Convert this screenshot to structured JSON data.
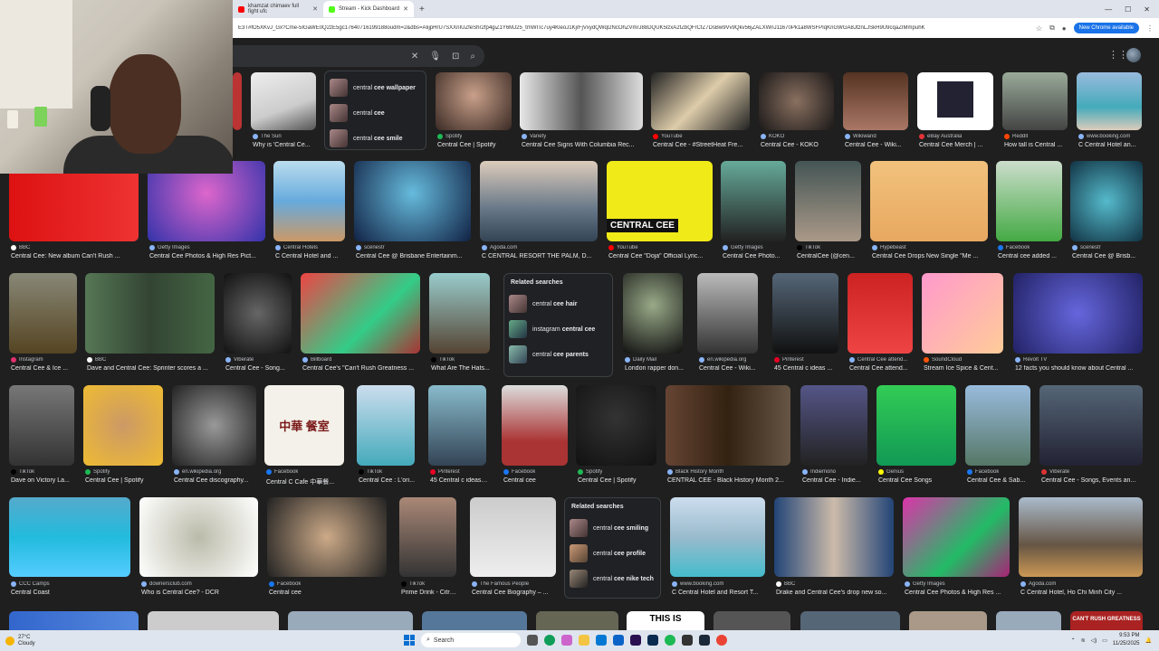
{
  "browser": {
    "tabs": [
      {
        "label": "khamzat chimaev full fight ufc",
        "favicon_color": "#ff0000",
        "active": false
      },
      {
        "label": "Stream - Kick Dashboard",
        "favicon_color": "#53fc18",
        "active": true
      }
    ],
    "url": "E3T#fO5XKvJ_Gx?Cme-5IGaWE0Q2zE5gc17640716199188oudm=2&dbs=AIijpHrU7SXXnIUZfeShr2fp4giZ1Y6MJ25_tmWITc7uy4KleoJ1KjrFjVxydQWql2NcOhZVmrJ88DQUK5lzxA2fZbQFrCfZ7DsBw9Vv9Qkv56jZALXWnJ11670Pk1a8WSFPIqKnGWGA8JtznLJSkH9U9cqaZIMmpuhK",
    "update_chip": "New Chrome available"
  },
  "colors": {
    "accent": "#1a73e8"
  },
  "related_top": [
    {
      "prefix": "central ",
      "bold": "cee wallpaper"
    },
    {
      "prefix": "central ",
      "bold": "cee"
    },
    {
      "prefix": "central ",
      "bold": "cee smile"
    }
  ],
  "row1": [
    {
      "source": "The Sun",
      "title": "Why is 'Central Ce..."
    },
    {
      "source": "Spotify",
      "title": "Central Cee | Spotify"
    },
    {
      "source": "Variety",
      "title": "Central Cee Signs With Columbia Rec..."
    },
    {
      "source": "YouTube",
      "title": "Central Cee - #StreetHeat Fre..."
    },
    {
      "source": "KOKO",
      "title": "Central Cee - KOKO"
    },
    {
      "source": "Wikiwand",
      "title": "Central Cee - Wiki..."
    },
    {
      "source": "eBay Australia",
      "title": "Central Cee Merch | ..."
    },
    {
      "source": "Reddit",
      "title": "How tall is Central ..."
    },
    {
      "source": "www.booking.com",
      "title": "C Central Hotel an..."
    }
  ],
  "row2": [
    {
      "source": "BBC",
      "title": "Central Cee: New album Can't Rush ..."
    },
    {
      "source": "Getty Images",
      "title": "Central Cee Photos & High Res Pict..."
    },
    {
      "source": "Central Hotels",
      "title": "C Central Hotel and ..."
    },
    {
      "source": "scenestr",
      "title": "Central Cee @ Brisbane Entertainm..."
    },
    {
      "source": "Agoda.com",
      "title": "C CENTRAL RESORT THE PALM, D..."
    },
    {
      "source": "YouTube",
      "title": "Central Cee \"Doja\" Official Lyric..."
    },
    {
      "source": "Getty Images",
      "title": "Central Cee Photo..."
    },
    {
      "source": "TikTok",
      "title": "CentralCee (@cen..."
    },
    {
      "source": "Hypebeast",
      "title": "Central Cee Drops New Single \"Me ..."
    },
    {
      "source": "Facebook",
      "title": "Central cee added ..."
    },
    {
      "source": "scenestr",
      "title": "Central Cee @ Brisb..."
    }
  ],
  "yellow_thumb_text": "CENTRAL CEE",
  "related_mid": {
    "heading": "Related searches",
    "items": [
      {
        "prefix": "central ",
        "bold": "cee hair"
      },
      {
        "prefix": "instagram ",
        "bold": "central cee"
      },
      {
        "prefix": "central ",
        "bold": "cee parents"
      }
    ]
  },
  "row3": [
    {
      "source": "Instagram",
      "title": "Central Cee & Ice ..."
    },
    {
      "source": "BBC",
      "title": "Dave and Central Cee: Sprinter scores a ..."
    },
    {
      "source": "Viberate",
      "title": "Central Cee - Song..."
    },
    {
      "source": "Billboard",
      "title": "Central Cee's \"Can't Rush Greatness ..."
    },
    {
      "source": "TikTok",
      "title": "What Are The Hats..."
    },
    {
      "source": "Daily Mail",
      "title": "London rapper don..."
    },
    {
      "source": "en.wikipedia.org",
      "title": "Central Cee - Wiki..."
    },
    {
      "source": "Pinterest",
      "title": "45 Central c ideas ..."
    },
    {
      "source": "Central Cee attend...",
      "title": "Central Cee attend..."
    },
    {
      "source": "SoundCloud",
      "title": "Stream Ice Spice & Cent..."
    },
    {
      "source": "Revolt TV",
      "title": "12 facts you should know about Central ..."
    }
  ],
  "row4": [
    {
      "source": "TikTok",
      "title": "Dave on Victory La..."
    },
    {
      "source": "Spotify",
      "title": "Central Cee | Spotify"
    },
    {
      "source": "en.wikipedia.org",
      "title": "Central Cee discography..."
    },
    {
      "source": "Facebook",
      "title": "Central C Cafe 中華餐..."
    },
    {
      "source": "TikTok",
      "title": "Central Cee : L'ori..."
    },
    {
      "source": "Pinterest",
      "title": "45 Central c ideas ..."
    },
    {
      "source": "Facebook",
      "title": "Central cee"
    },
    {
      "source": "Spotify",
      "title": "Central Cee | Spotify"
    },
    {
      "source": "Black History Month",
      "title": "CENTRAL CEE - Black History Month 2..."
    },
    {
      "source": "Indiemono",
      "title": "Central Cee - Indie..."
    },
    {
      "source": "Genius",
      "title": "Central Cee Songs"
    },
    {
      "source": "Facebook",
      "title": "Central Cee & Sab..."
    },
    {
      "source": "Viberate",
      "title": "Central Cee - Songs, Events an..."
    }
  ],
  "cafe_sign": "中華 餐室",
  "row5": [
    {
      "source": "CCC Camps",
      "title": "Central Coast"
    },
    {
      "source": "downersclub.com",
      "title": "Who is Central Cee? - DCR"
    },
    {
      "source": "Facebook",
      "title": "Central cee"
    },
    {
      "source": "TikTok",
      "title": "Prime Drink - Citru..."
    },
    {
      "source": "The Famous People",
      "title": "Central Cee Biography – ..."
    },
    {
      "source": "www.booking.com",
      "title": "C Central Hotel and Resort T..."
    },
    {
      "source": "BBC",
      "title": "Drake and Central Cee's drop new so..."
    },
    {
      "source": "Getty Images",
      "title": "Central Cee Photos & High Res ..."
    },
    {
      "source": "Agoda.com",
      "title": "C Central Hotel, Ho Chi Minh City ..."
    }
  ],
  "related_low": {
    "heading": "Related searches",
    "items": [
      {
        "prefix": "central ",
        "bold": "cee smiling"
      },
      {
        "prefix": "central ",
        "bold": "cee profile"
      },
      {
        "prefix": "central ",
        "bold": "cee nike tech"
      }
    ]
  },
  "bottom_texts": {
    "this_is": "THIS IS",
    "cant_rush": "CAN'T RUSH GREATNESS"
  },
  "taskbar": {
    "temp": "27°C",
    "weather": "Cloudy",
    "search_placeholder": "Search",
    "time": "9:53 PM",
    "date": "11/25/2025"
  }
}
